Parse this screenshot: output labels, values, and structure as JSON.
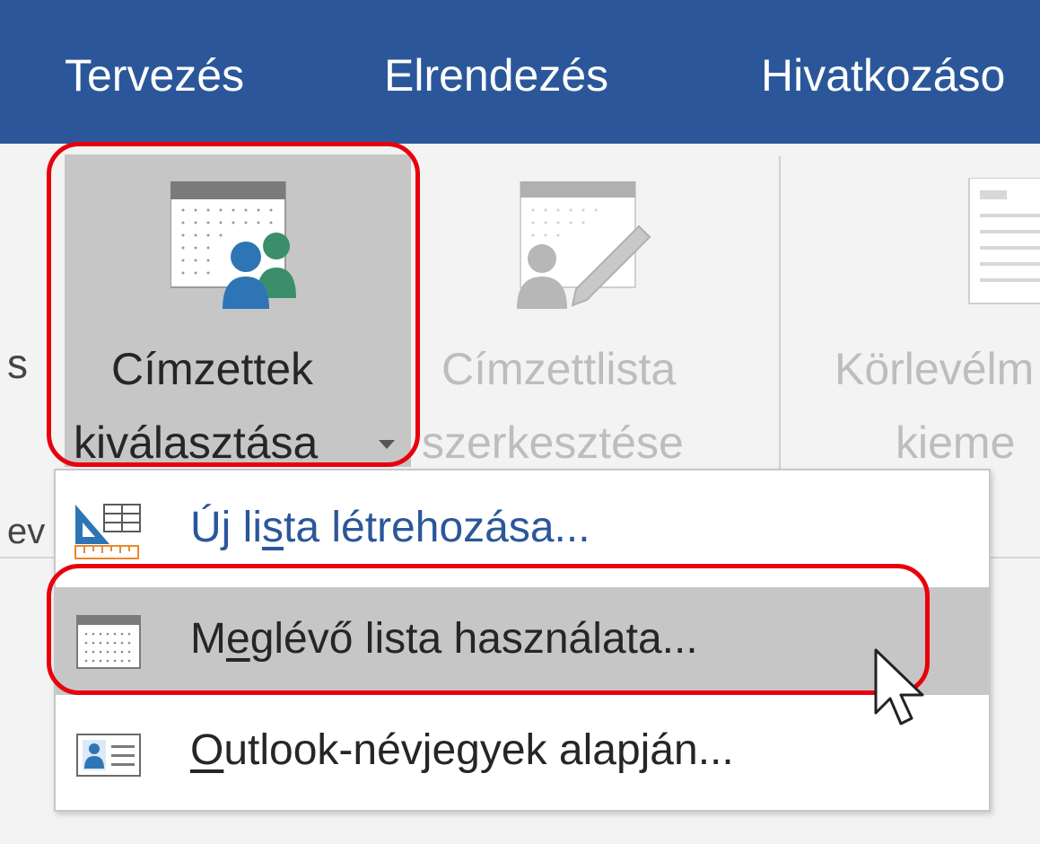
{
  "tabs": [
    {
      "label": "Tervezés"
    },
    {
      "label": "Elrendezés"
    },
    {
      "label": "Hivatkozáso"
    }
  ],
  "ribbon": {
    "partial_left_text": "s",
    "group_label_partial": "ev",
    "select_recipients": {
      "line1": "Címzettek",
      "line2": "kiválasztása",
      "icon": "select-recipients-icon",
      "has_dropdown": true
    },
    "edit_recipient_list": {
      "line1": "Címzettlista",
      "line2": "szerkesztése",
      "icon": "edit-recipient-list-icon",
      "enabled": false
    },
    "highlight_merge_fields": {
      "line1": "Körlevélm",
      "line2": "kieme",
      "icon": "merge-fields-icon",
      "enabled": false
    }
  },
  "menu": {
    "items": [
      {
        "pre": "Új li",
        "key": "s",
        "post": "ta létrehozása...",
        "icon": "new-list-icon"
      },
      {
        "pre": "M",
        "key": "e",
        "post": "glévő lista használata...",
        "icon": "existing-list-icon",
        "hovered": true
      },
      {
        "pre": "",
        "key": "O",
        "post": "utlook-névjegyek alapján...",
        "icon": "outlook-contacts-icon"
      }
    ]
  },
  "colors": {
    "tab_bar": "#2b579a",
    "ribbon_bg": "#f3f3f3",
    "selected_button": "#c6c6c6",
    "highlight": "#e8000e",
    "menu_hover": "#c6c6c6",
    "menu_text_item1": "#2b579a",
    "menu_text": "#262626",
    "disabled_text": "#bdbdbd"
  }
}
